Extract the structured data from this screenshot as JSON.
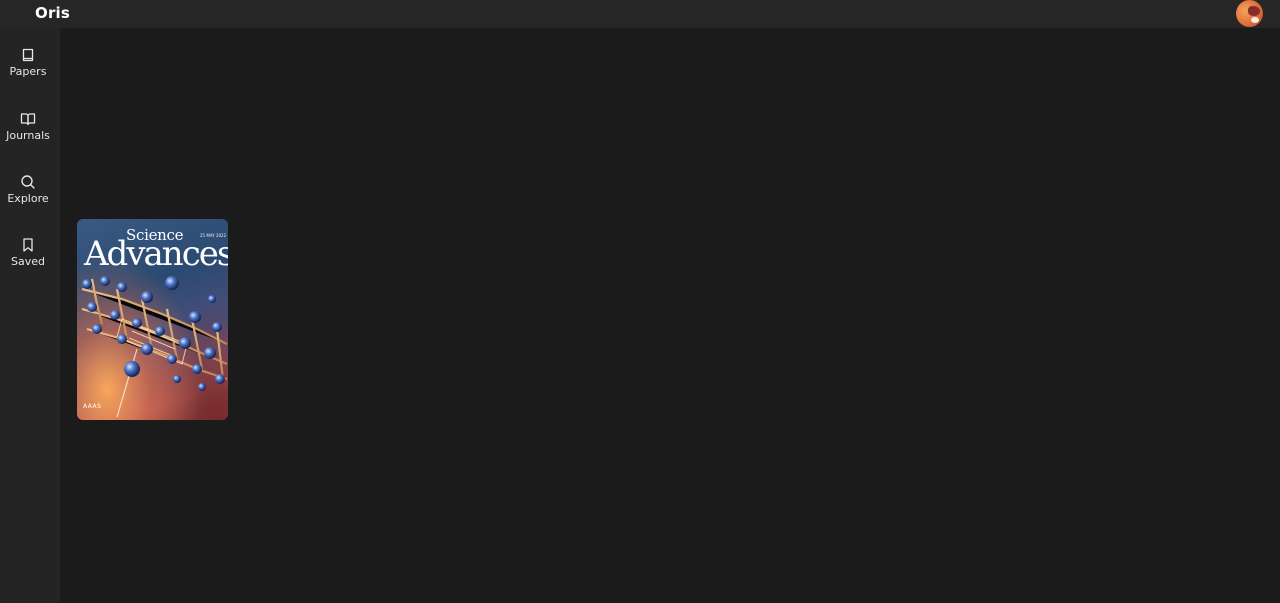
{
  "app": {
    "title": "Oris"
  },
  "sidebar": {
    "items": [
      {
        "label": "Papers",
        "icon": "book-icon"
      },
      {
        "label": "Journals",
        "icon": "open-book-icon"
      },
      {
        "label": "Explore",
        "icon": "search-icon"
      },
      {
        "label": "Saved",
        "icon": "bookmark-icon"
      }
    ]
  },
  "main": {
    "journals": [
      {
        "cover_title_top": "Science",
        "cover_title_main": "Advances",
        "cover_date": "25 MAY 2022",
        "cover_publisher": "AAAS"
      }
    ]
  },
  "colors": {
    "background": "#1b1b1b",
    "topbar": "#262626",
    "sidebar": "#242424",
    "text": "#e6e6e6"
  }
}
